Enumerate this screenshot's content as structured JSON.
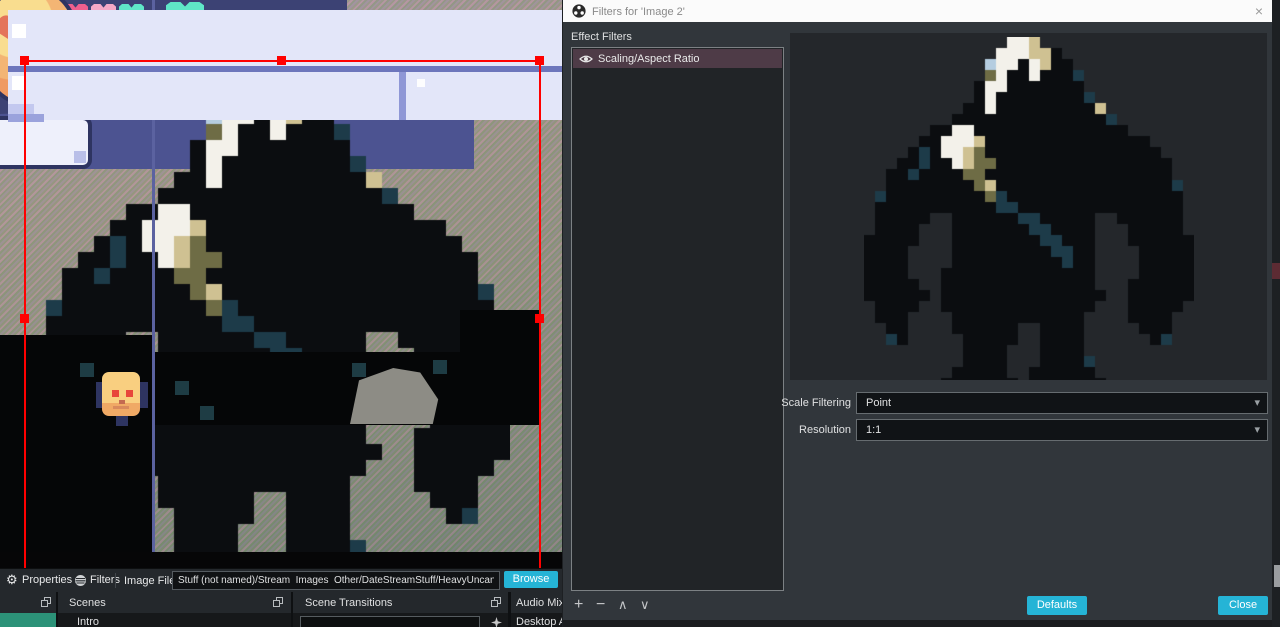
{
  "dialog": {
    "title": "Filters for 'Image 2'",
    "effect_filters_label": "Effect Filters",
    "filters": [
      {
        "name": "Scaling/Aspect Ratio"
      }
    ],
    "fields": [
      {
        "label": "Scale Filtering",
        "value": "Point"
      },
      {
        "label": "Resolution",
        "value": "1:1"
      }
    ],
    "buttons": {
      "defaults": "Defaults",
      "close": "Close"
    }
  },
  "main": {
    "source_toolbar": {
      "properties_label": "Properties",
      "filters_label": "Filters",
      "field_label": "Image File",
      "path_value": "Stuff (not named)/Stream  Images  Other/DateStreamStuff/HeavyUncanny.png",
      "browse_label": "Browse"
    },
    "docks": [
      {
        "title": ""
      },
      {
        "title": "Scenes",
        "items": [
          "Intro"
        ]
      },
      {
        "title": "Scene Transitions"
      },
      {
        "title": "Audio Mixer",
        "items": [
          "Desktop Audio"
        ]
      }
    ]
  },
  "icons": {
    "add": "+",
    "remove": "−",
    "move_up": "∧",
    "move_down": "∨",
    "close": "×",
    "dropdown": "▾",
    "gear": "⚙"
  },
  "colors": {
    "accent_button": "#25b4d6",
    "selection_red": "#ff0000",
    "selected_filter_bg": "#4e3b47",
    "selected_dock_item": "#2c9278",
    "game_sky": "#3c4274"
  },
  "game": {
    "hearts": [
      "#8e2f52",
      "#cc3f68",
      "#ef5f8d",
      "#f5a8c6",
      "#5fe7c7"
    ],
    "big_heart": "#5fe7c7"
  },
  "pixel_art": {
    "palette": {
      "K": "#0b0d10",
      "T": "#1d3b49",
      "W": "#f3f1ea",
      "C": "#cfc192",
      "O": "#6e6c45",
      "B": "#b5cde0"
    },
    "rows": [
      ".............WWC..............",
      "............WWWCCK............",
      "...........BWWKWCKK...........",
      "...........OWKKWKKKT..........",
      "..........KWWKKKKKKK..........",
      "..........KWKKKKKKKKT.........",
      ".........KKWKKKKKKKKKC........",
      "........KKKKKKKKKKKKKKT.......",
      "......KKWWKKKKKKKKKKKKKK......",
      ".....KKWWWCKKKKKKKKKKKKKKK....",
      "....KTKWWCOKKKKKKKKKKKKKKKK...",
      "...KKTKKWCOOKKKKKKKKKKKKKKKK..",
      "..KKTKKKKOOKKKKKKKKKKKKKKKKK..",
      "..KKKKKKKKOCKKKKKKKKKKKKKKKKT.",
      ".TKKKKKKKKKOTKKKKKKKKKKKKKKKK.",
      ".KKKKKKKKKKKTTKKKKKKKKKKKKKKK.",
      ".KKKKK..KKKKKKTTKKKKK..KKKKKK.",
      ".KKKK...KKKKKKKTTKKKK...KKKKK.",
      "KKKKK...KKKKKKKKTTKKK...KKKKKK",
      "KKKK....KKKKKKKKKTTKK....KKKKK",
      "KKKK....KKKKKKKKKKTKK....KKKKK",
      "KKKK...KKKKKKKKKKKKKK....KKKKK",
      "KKKKK..KKKKKKKKKKKKKK...KKKKKK",
      "KKKKKK.KKKKKKKKKKKKKKK..KKKKKK",
      ".KKKK..KKKKKKKKKKKKKK...KKKKK.",
      ".KKK....KKKKKKKKKKKK....KKKK..",
      "..KK....KKKKKK..KKKK.....KKK..",
      "..TK.....KKKKK..KKKK......KT..",
      ".........KKKK...KKKK..........",
      ".........KKKK...KKKKT.........",
      "........KKKKK..KKKKKK.........",
      ".......KKKKKKK.KKKKKKK........"
    ]
  }
}
